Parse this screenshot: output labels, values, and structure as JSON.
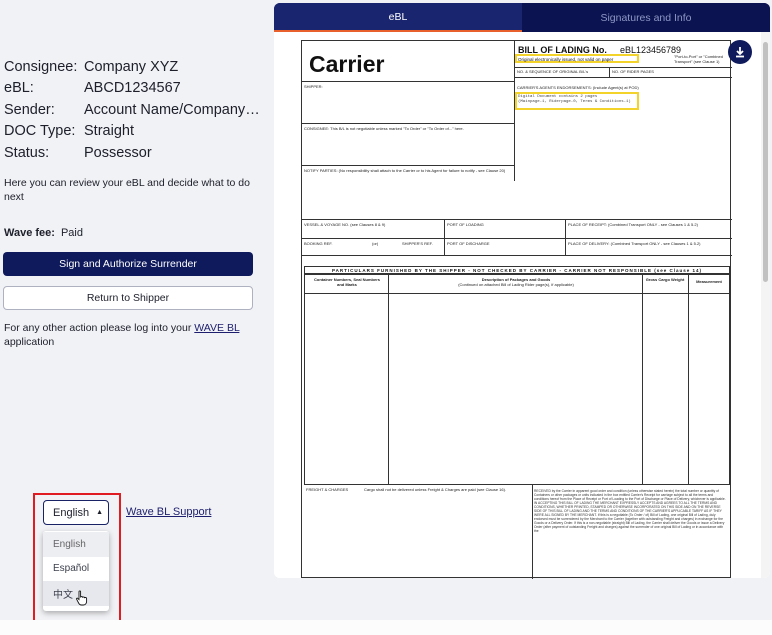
{
  "info": [
    {
      "label": "Consignee:",
      "value": "Company XYZ"
    },
    {
      "label": "eBL:",
      "value": "ABCD1234567"
    },
    {
      "label": "Sender:",
      "value": "Account Name/Company Name"
    },
    {
      "label": "DOC Type:",
      "value": "Straight"
    },
    {
      "label": "Status:",
      "value": "Possessor"
    }
  ],
  "description": "Here you can review your eBL and decide what to do next",
  "fee": {
    "label": "Wave fee:",
    "value": "Paid"
  },
  "buttons": {
    "sign": "Sign and Authorize Surrender",
    "return": "Return to Shipper"
  },
  "note": {
    "text": "For any other action please log into your ",
    "link": "WAVE BL",
    "suffix": " application"
  },
  "language": {
    "selected": "English",
    "options": [
      "English",
      "Español",
      "中文"
    ]
  },
  "support_link": "Wave BL Support",
  "tabs": [
    {
      "label": "eBL",
      "active": true
    },
    {
      "label": "Signatures and Info",
      "active": false
    }
  ],
  "document": {
    "carrier": "Carrier",
    "title": "BILL OF LADING No.",
    "number": "eBL123456789",
    "port_note": "\"Port-to-Port\" or \"Combined Transport\" (see Clause 1)",
    "original_note": "Original electronically issued, not valid on paper",
    "shipper": "SHIPPER:",
    "consignee": "CONSIGNEE: This B/L is not negotiable unless marked \"To Order\" or \"To Order of...\" here.",
    "notify": "NOTIFY PARTIES: (No responsibility shall attach to the Carrier or to his Agent for failure to notify - see Clause 20)",
    "seq": "NO. & SEQUENCE OF ORIGINAL B/L's",
    "rider": "NO. OF RIDER PAGES",
    "endorsements": "CARRIER'S AGENTS ENDORSEMENTS: (Include Agent(s) at POD)",
    "endorse_text1": "Digital Document contains 2 pages",
    "endorse_text2": "(Mainpage-1, Riderpage-0, Terms & Conditions-1)",
    "vessel": "VESSEL & VOYAGE NO. (see Clauses 8 & 9)",
    "port_loading": "PORT OF LOADING",
    "receipt": "PLACE OF RECEIPT: (Combined Transport ONLY - see Clauses 1 & 5.2)",
    "booking": "BOOKING REF.",
    "or": "(or)",
    "shippers_ref": "SHIPPER'S REF.",
    "port_discharge": "PORT OF DISCHARGE",
    "delivery": "PLACE OF DELIVERY: (Combined Transport ONLY - see Clauses 1 & 5.2)",
    "particulars": "PARTICULARS FURNISHED BY THE SHIPPER - NOT CHECKED BY CARRIER - CARRIER NOT RESPONSIBLE",
    "particulars_clause": "(see Clause 14)",
    "col_containers": "Container Numbers, Seal Numbers and Marks",
    "col_description": "Description of Packages and Goods",
    "col_description_sub": "(Continued on attached Bill of Lading Rider page(s), if applicable)",
    "col_weight": "Gross Cargo Weight",
    "col_measure": "Measurement",
    "freight": "FREIGHT & CHARGES",
    "freight_note": "Cargo shall not be delivered unless Freight & Charges are paid (see Clause 16).",
    "small_print": "RECEIVED by the Carrier in apparent good order and condition (unless otherwise stated herein) the total number or quantity of Containers or other packages or units indicated in the box entitled Carrier's Receipt for carriage subject to all the terms and conditions hereof from the Place of Receipt or Port of Loading to the Port of Discharge or Place of Delivery, whichever is applicable. IN ACCEPTING THIS BILL OF LADING THE MERCHANT EXPRESSLY ACCEPTS AND AGREES TO ALL THE TERMS AND CONDITIONS, WHETHER PRINTED, STAMPED OR OTHERWISE INCORPORATED ON THIS SIDE AND ON THE REVERSE SIDE OF THIS BILL OF LADING AND THE TERMS AND CONDITIONS OF THE CARRIER'S APPLICABLE TARIFF AS IF THEY WERE ALL SIGNED BY THE MERCHANT. If this is a negotiable (To Order / of) Bill of Lading, one original Bill of Lading, duly endorsed must be surrendered by the Merchant to the Carrier (together with outstanding Freight and charges) in exchange for the Goods or a Delivery Order. If this is a non-negotiable (straight) Bill of Lading, the Carrier shall deliver the Goods or issue a Delivery Order (after payment of outstanding Freight and charges) against the surrender of one original Bill of Lading or in accordance with the"
  },
  "colors": {
    "navy": "#0e1a5c",
    "accent": "#e8612c",
    "highlight": "#e01b22",
    "yellow": "#f3d22a"
  }
}
